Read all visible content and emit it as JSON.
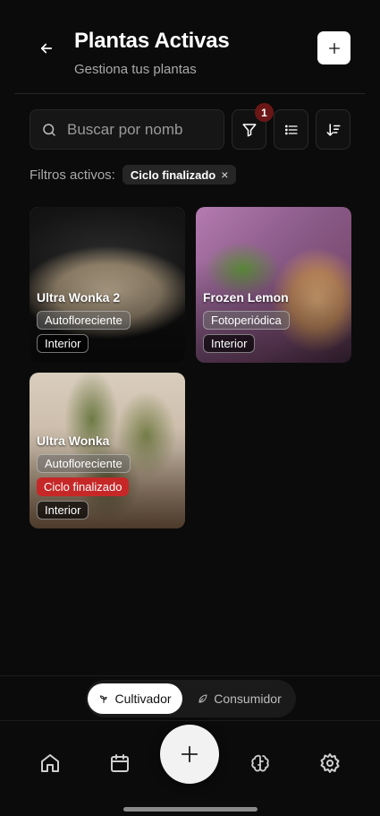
{
  "header": {
    "title": "Plantas Activas",
    "subtitle": "Gestiona tus plantas",
    "back_icon": "arrow-left-icon",
    "add_icon": "plus-icon"
  },
  "search": {
    "placeholder": "Buscar por nomb",
    "value": ""
  },
  "toolbar": {
    "filter_icon": "filter-icon",
    "filter_count": "1",
    "list_icon": "list-icon",
    "sort_icon": "sort-icon"
  },
  "filters": {
    "label": "Filtros activos:",
    "chips": [
      {
        "label": "Ciclo finalizado",
        "remove": "×"
      }
    ]
  },
  "plants": [
    {
      "name": "Ultra Wonka 2",
      "type": "Autofloreciente",
      "location": "Interior",
      "status": ""
    },
    {
      "name": "Frozen Lemon",
      "type": "Fotoperiódica",
      "location": "Interior",
      "status": ""
    },
    {
      "name": "Ultra Wonka",
      "type": "Autofloreciente",
      "location": "Interior",
      "status": "Ciclo finalizado"
    }
  ],
  "mode_switch": {
    "options": [
      {
        "label": "Cultivador",
        "icon": "sprout-icon",
        "active": true
      },
      {
        "label": "Consumidor",
        "icon": "leaf-icon",
        "active": false
      }
    ]
  },
  "bottom_nav": {
    "items": [
      "home-icon",
      "calendar-icon",
      "plus-icon",
      "brain-icon",
      "gear-icon"
    ]
  },
  "colors": {
    "background": "#0b0b0b",
    "accent_red": "#c62828",
    "badge_red": "#6b1717"
  }
}
